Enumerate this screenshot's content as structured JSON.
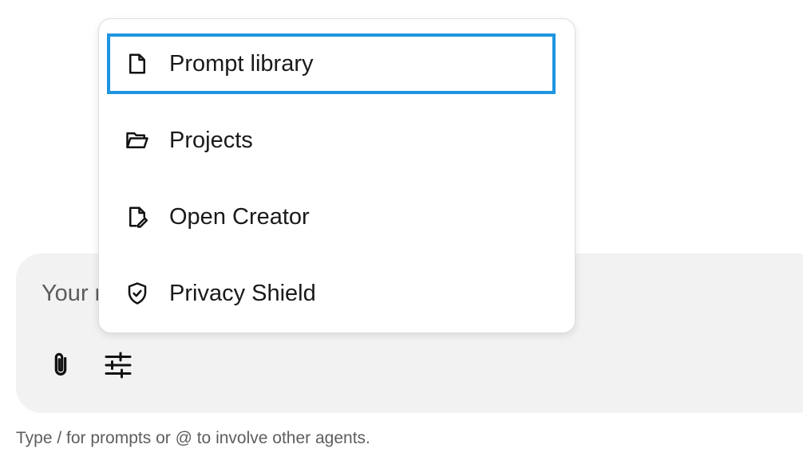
{
  "composer": {
    "placeholder": "Your message",
    "attach_icon": "paperclip-icon",
    "tools_icon": "sliders-icon"
  },
  "hint": "Type / for prompts or @ to involve other agents.",
  "menu": {
    "items": [
      {
        "label": "Prompt library",
        "icon": "document-icon",
        "active": true
      },
      {
        "label": "Projects",
        "icon": "folder-open-icon",
        "active": false
      },
      {
        "label": "Open Creator",
        "icon": "file-edit-icon",
        "active": false
      },
      {
        "label": "Privacy Shield",
        "icon": "shield-check-icon",
        "active": false
      }
    ]
  },
  "colors": {
    "focus_ring": "#1e95e0",
    "composer_bg": "#f2f2f2",
    "hint_text": "#5e5e5e"
  }
}
